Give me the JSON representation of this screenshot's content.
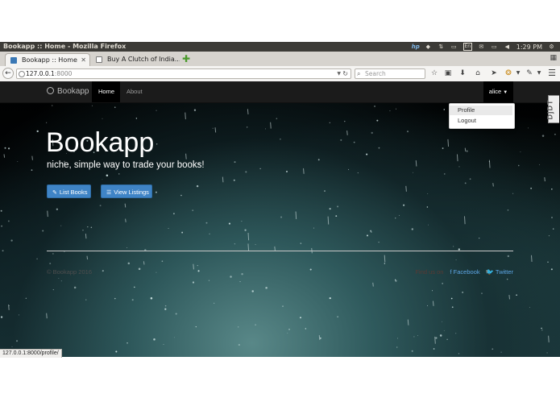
{
  "os_panel": {
    "window_title": "Bookapp :: Home - Mozilla Firefox",
    "tray_icons": [
      "hp-icon",
      "dropbox-icon",
      "network-updown-icon",
      "keyboard-icon",
      "en-layout-icon",
      "mail-icon",
      "battery-icon",
      "volume-icon"
    ],
    "keyboard_label": "En",
    "clock": "1:29 PM"
  },
  "browser": {
    "tabs": [
      {
        "label": "Bookapp :: Home",
        "active": true
      },
      {
        "label": "Buy A Clutch of India...",
        "active": false
      }
    ],
    "url": {
      "host": "127.0.0.1",
      "port": ":8000"
    },
    "search_placeholder": "Search",
    "status_url": "127.0.0.1:8000/profile/"
  },
  "site": {
    "brand": "Bookapp",
    "nav": {
      "home": "Home",
      "about": "About",
      "user": "alice"
    },
    "user_menu": {
      "profile": "Profile",
      "logout": "Logout"
    },
    "ddt_label": "DjDT",
    "hero": {
      "title": "Bookapp",
      "tagline": "niche, simple way to trade your books!",
      "btn_list_books": "List Books",
      "btn_view_listings": "View Listings"
    },
    "footer": {
      "copyright": "© Bookapp 2016",
      "find_us": "Find us on",
      "facebook": "Facebook",
      "twitter": "Twitter"
    }
  },
  "colors": {
    "navbar": "#1b1b1b",
    "primary_button": "#3f84c6",
    "link": "#5da6e6"
  }
}
